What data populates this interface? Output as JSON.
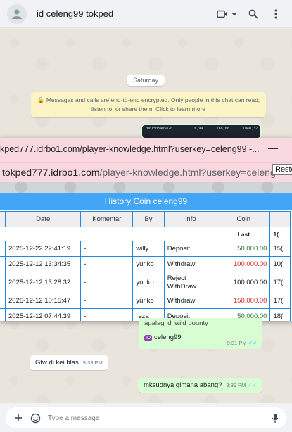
{
  "header": {
    "title": "id celeng99 tokped",
    "icons": [
      "video-call-icon",
      "chevron-down-icon",
      "search-icon",
      "more-options-icon"
    ]
  },
  "chat": {
    "day_label": "Saturday",
    "encryption_notice": "Messages and calls are end-to-end encrypted. Only people in this chat can read, listen to, or share them. Click to learn more",
    "image_preview_text": [
      "2001503405820 ...",
      "6,99",
      "768,00",
      "1040,32"
    ]
  },
  "popup": {
    "window_title": "kped777.idrbo1.com/player-knowledge.html?userkey=celeng99 -...",
    "minimize_label": "—",
    "address_host": "tokped777.idrbo1.com",
    "address_path": "/player-knowledge.html?userkey=celeng",
    "tooltip": "Resto",
    "page_title": "History Coin celeng99",
    "columns": [
      "",
      "Date",
      "Komentar",
      "By",
      "info",
      "Coin",
      ""
    ],
    "subheader": [
      "Last",
      "1("
    ],
    "rows": [
      {
        "date": "2025-12-22 22:41:19",
        "komentar": "-",
        "by": "willy",
        "info": "Deposit",
        "coin": "50,000.00",
        "coin_type": "pos",
        "last": "15("
      },
      {
        "date": "2025-12-12 13:34:35",
        "komentar": "-",
        "by": "yuriko",
        "info": "Withdraw",
        "coin": "100,000.00",
        "coin_type": "neg",
        "last": "10("
      },
      {
        "date": "2025-12-12 13:28:32",
        "komentar": "-",
        "by": "yuriko",
        "info": "Reject WithDraw",
        "coin": "100,000.00",
        "coin_type": "neutral",
        "last": "17("
      },
      {
        "date": "2025-12-12 10:15:47",
        "komentar": "-",
        "by": "yuriko",
        "info": "Withdraw",
        "coin": "150,000.00",
        "coin_type": "neg",
        "last": "17("
      },
      {
        "date": "2025-12-12 07:44:39",
        "komentar": "-",
        "by": "reza",
        "info": "Deposit",
        "coin": "50,000.00",
        "coin_type": "pos",
        "last": "18("
      }
    ]
  },
  "messages": {
    "quote_line": "apalagi di wild bounty",
    "quote_chip": "ID",
    "quote_user": "celeng99",
    "quote_time": "9:31 PM",
    "incoming_text": "Gtw di kei blas",
    "incoming_time": "9:33 PM",
    "outgoing_text": "mksudnya gimana abang?",
    "outgoing_time": "9:39 PM",
    "ticks": "✓✓"
  },
  "composer": {
    "placeholder": "Type a message"
  },
  "colors": {
    "header_bg": "#f0f2f5",
    "popup_bar": "#f9d8e0",
    "page_title_bg": "#42a5f5",
    "outgoing_bubble": "#d9fdd3",
    "deposit_green": "#2e7d32",
    "withdraw_red": "#d32f2f"
  }
}
